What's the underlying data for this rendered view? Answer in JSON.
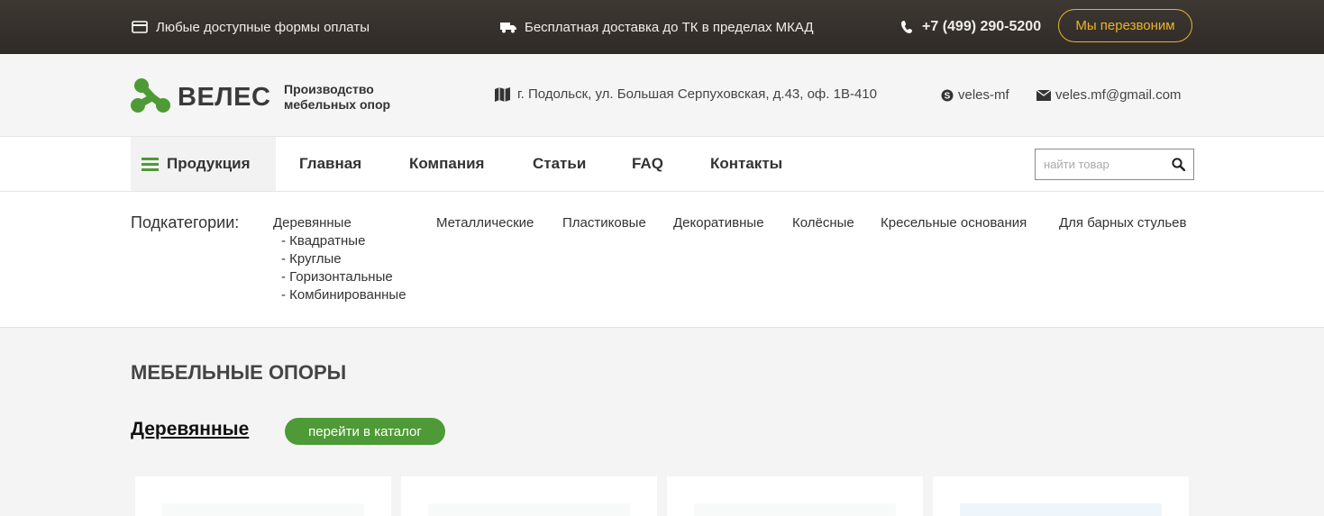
{
  "topbar": {
    "payment_text": "Любые доступные формы оплаты",
    "delivery_text": "Бесплатная доставка до ТК в пределах МКАД",
    "phone": "+7 (499) 290-5200",
    "callback_label": "Мы перезвоним"
  },
  "header": {
    "logo_text": "ВЕЛЕС",
    "tagline_line1": "Производство",
    "tagline_line2": "мебельных опор",
    "address": "г. Подольск, ул. Большая Серпуховская, д.43, оф. 1В-410",
    "skype": "veles-mf",
    "email": "veles.mf@gmail.com"
  },
  "nav": {
    "products": "Продукция",
    "links": [
      "Главная",
      "Компания",
      "Статьи",
      "FAQ",
      "Контакты"
    ],
    "search_placeholder": "найти товар"
  },
  "subcategories": {
    "label": "Подкатегории:",
    "categories": [
      "Деревянные",
      "Металлические",
      "Пластиковые",
      "Декоративные",
      "Колёсные",
      "Кресельные основания",
      "Для барных стульев"
    ],
    "wood_children": [
      "- Квадратные",
      "- Круглые",
      "- Горизонтальные",
      "- Комбинированные"
    ]
  },
  "content": {
    "main_title": "МЕБЕЛЬНЫЕ ОПОРЫ",
    "section_title": "Деревянные",
    "catalog_button": "перейти в каталог"
  },
  "colors": {
    "brand_green": "#4e9a36",
    "accent_yellow": "#e9b429",
    "topbar_bg": "#332e2a"
  }
}
